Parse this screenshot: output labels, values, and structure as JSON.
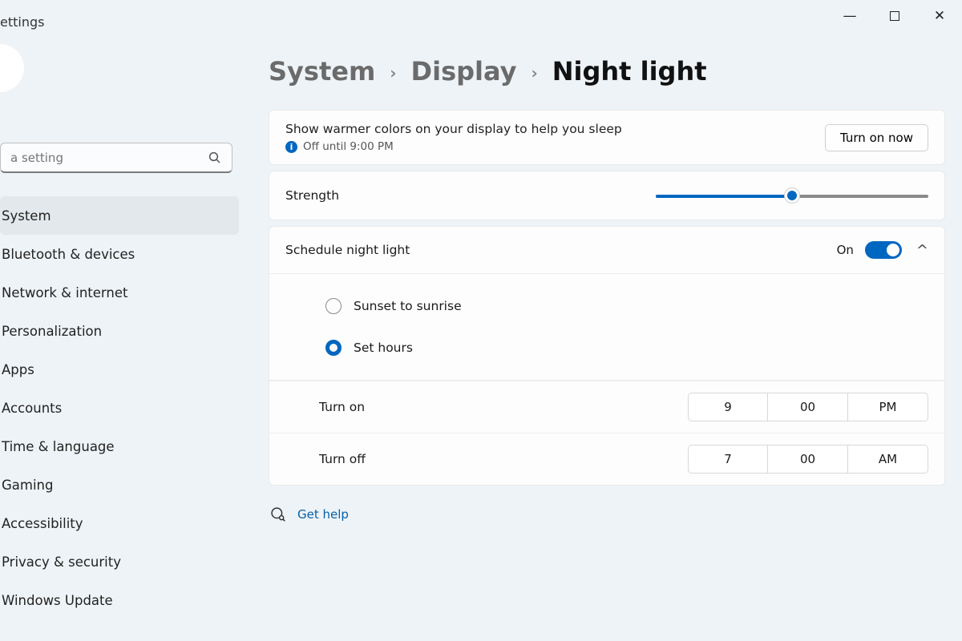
{
  "app_title": "ettings",
  "window": {
    "minimize": "—",
    "maximize": "☐",
    "close": "✕"
  },
  "search": {
    "placeholder": "a setting"
  },
  "sidebar": {
    "items": [
      {
        "label": "System",
        "active": true
      },
      {
        "label": "Bluetooth & devices"
      },
      {
        "label": "Network & internet"
      },
      {
        "label": "Personalization"
      },
      {
        "label": "Apps"
      },
      {
        "label": "Accounts"
      },
      {
        "label": "Time & language"
      },
      {
        "label": "Gaming"
      },
      {
        "label": "Accessibility"
      },
      {
        "label": "Privacy & security"
      },
      {
        "label": "Windows Update"
      }
    ]
  },
  "breadcrumb": {
    "a": "System",
    "b": "Display",
    "c": "Night light",
    "sep": "›"
  },
  "intro": {
    "headline": "Show warmer colors on your display to help you sleep",
    "status": "Off until 9:00 PM",
    "button": "Turn on now"
  },
  "strength": {
    "label": "Strength",
    "value": 50,
    "max": 100
  },
  "schedule": {
    "label": "Schedule night light",
    "state": "On",
    "options": {
      "sunset": "Sunset to sunrise",
      "hours": "Set hours",
      "selected": "hours"
    },
    "turn_on": {
      "label": "Turn on",
      "hour": "9",
      "minute": "00",
      "ampm": "PM"
    },
    "turn_off": {
      "label": "Turn off",
      "hour": "7",
      "minute": "00",
      "ampm": "AM"
    }
  },
  "help": {
    "label": "Get help"
  }
}
